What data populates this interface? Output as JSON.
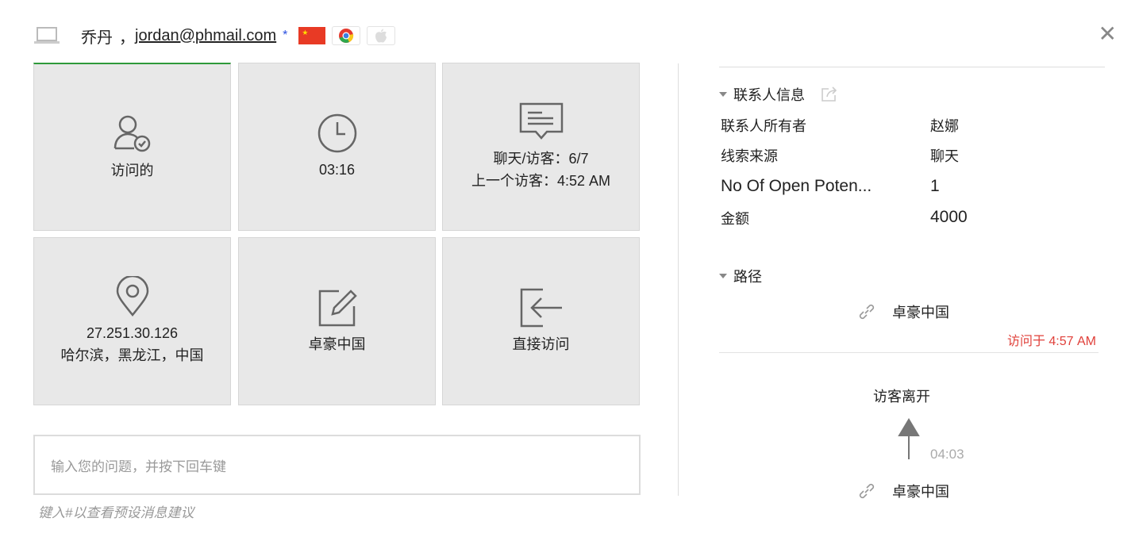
{
  "header": {
    "name": "乔丹",
    "separator": "，",
    "email": "jordan@phmail.com",
    "star": "*"
  },
  "tiles": [
    {
      "label": "访问的",
      "icon": "user-check-icon"
    },
    {
      "label": "03:16",
      "icon": "clock-icon"
    },
    {
      "label": "聊天/访客：6/7",
      "label2": "上一个访客：4:52 AM",
      "icon": "chat-icon"
    },
    {
      "label": "27.251.30.126",
      "label2": "哈尔滨，黑龙江，中国",
      "icon": "location-pin-icon"
    },
    {
      "label": "卓豪中国",
      "icon": "edit-icon"
    },
    {
      "label": "直接访问",
      "icon": "sign-in-icon"
    }
  ],
  "input": {
    "placeholder": "输入您的问题，并按下回车键"
  },
  "hint": "键入#以查看预设消息建议",
  "contact": {
    "title": "联系人信息",
    "rows": [
      {
        "label": "联系人所有者",
        "value": "赵娜"
      },
      {
        "label": "线索来源",
        "value": "聊天"
      },
      {
        "label": "No Of Open Poten...",
        "value": "1"
      },
      {
        "label": "金额",
        "value": "4000"
      }
    ]
  },
  "path": {
    "title": "路径",
    "first_page": "卓豪中国",
    "visited_at": "访问于 4:57 AM",
    "leave": "访客离开",
    "duration": "04:03",
    "second_page": "卓豪中国"
  }
}
